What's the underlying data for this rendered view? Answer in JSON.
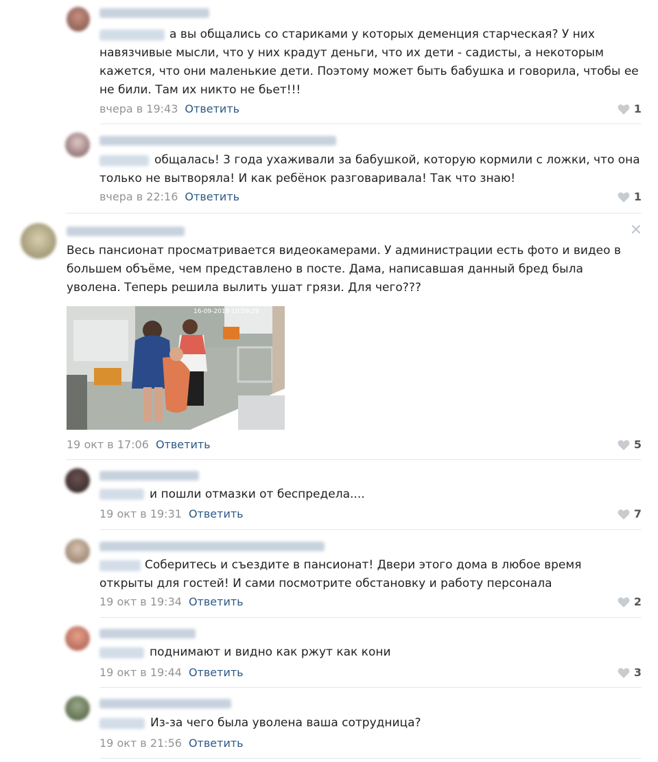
{
  "reply_label": "Ответить",
  "comments": [
    {
      "text_lines": [
        "а вы общались со стариками у которых деменция старческая? У них",
        "навязчивые мысли, что у них крадут деньги, что их дети - садисты, а некоторым",
        "кажется, что они маленькие дети. Поэтому может быть бабушка и говорила, чтобы ее",
        "не били. Там их никто не бьет!!!"
      ],
      "date": "вчера в 19:43",
      "likes": "1"
    },
    {
      "text_lines": [
        "общалась! 3 года ухаживали за бабушкой, которую кормили с ложки, что она",
        "только не вытворяла! И как ребёнок разговаривала! Так что знаю!"
      ],
      "date": "вчера в 22:16",
      "likes": "1"
    },
    {
      "text_lines": [
        "Весь пансионат просматривается видеокамерами. У администрации есть фото и видео в",
        "большем объёме, чем представлено в посте. Дама, написавшая данный бред была",
        "уволена. Теперь решила вылить ушат грязи. Для чего???"
      ],
      "photo_timestamp": "16-09-2019 10:59:29",
      "date": "19 окт в 17:06",
      "likes": "5"
    },
    {
      "text_lines": [
        "и пошли отмазки от беспредела...."
      ],
      "date": "19 окт в 19:31",
      "likes": "7"
    },
    {
      "text_lines": [
        "Соберитесь и съездите в пансионат! Двери этого дома в любое время",
        "открыты для гостей! И сами посмотрите обстановку и работу персонала"
      ],
      "date": "19 окт в 19:34",
      "likes": "2"
    },
    {
      "text_lines": [
        "поднимают и видно как ржут как кони"
      ],
      "date": "19 окт в 19:44",
      "likes": "3"
    },
    {
      "text_lines": [
        "Из-за чего была уволена ваша сотрудница?"
      ],
      "date": "19 окт в 21:56",
      "likes": ""
    }
  ],
  "colors": {
    "link": "#2a5885",
    "date": "#939393",
    "text": "#222222",
    "divider": "#e4e6ea",
    "blurred_name": "#c5d0dc"
  }
}
